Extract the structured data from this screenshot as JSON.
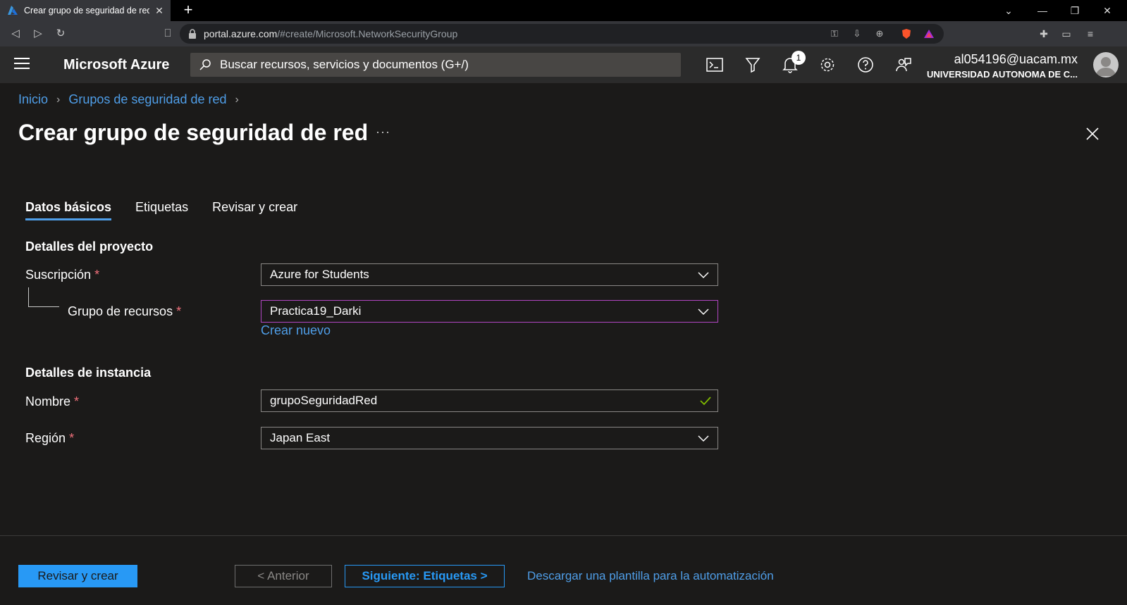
{
  "browser": {
    "tab_title": "Crear grupo de seguridad de red",
    "url_host": "portal.azure.com",
    "url_path": "/#create/Microsoft.NetworkSecurityGroup"
  },
  "azure": {
    "brand": "Microsoft Azure",
    "search_placeholder": "Buscar recursos, servicios y documentos (G+/)",
    "notification_count": "1",
    "account_email": "al054196@uacam.mx",
    "account_org": "UNIVERSIDAD AUTONOMA DE C..."
  },
  "breadcrumb": {
    "home": "Inicio",
    "section": "Grupos de seguridad de red"
  },
  "page": {
    "title": "Crear grupo de seguridad de red",
    "more": "···"
  },
  "tabs": [
    {
      "label": "Datos básicos"
    },
    {
      "label": "Etiquetas"
    },
    {
      "label": "Revisar y crear"
    }
  ],
  "project": {
    "heading": "Detalles del proyecto",
    "subscription_label": "Suscripción",
    "subscription_value": "Azure for Students",
    "resource_group_label": "Grupo de recursos",
    "resource_group_value": "Practica19_Darki",
    "create_new": "Crear nuevo"
  },
  "instance": {
    "heading": "Detalles de instancia",
    "name_label": "Nombre",
    "name_value": "grupoSeguridadRed",
    "region_label": "Región",
    "region_value": "Japan East"
  },
  "required_mark": "*",
  "footer": {
    "review_create": "Revisar y crear",
    "previous": "< Anterior",
    "next": "Siguiente: Etiquetas >",
    "download_template": "Descargar una plantilla para la automatización"
  },
  "colors": {
    "accent": "#2899f5",
    "link": "#4f9ee8",
    "required": "#f1707b",
    "focus_border": "#b146c2",
    "valid": "#7fba00"
  }
}
